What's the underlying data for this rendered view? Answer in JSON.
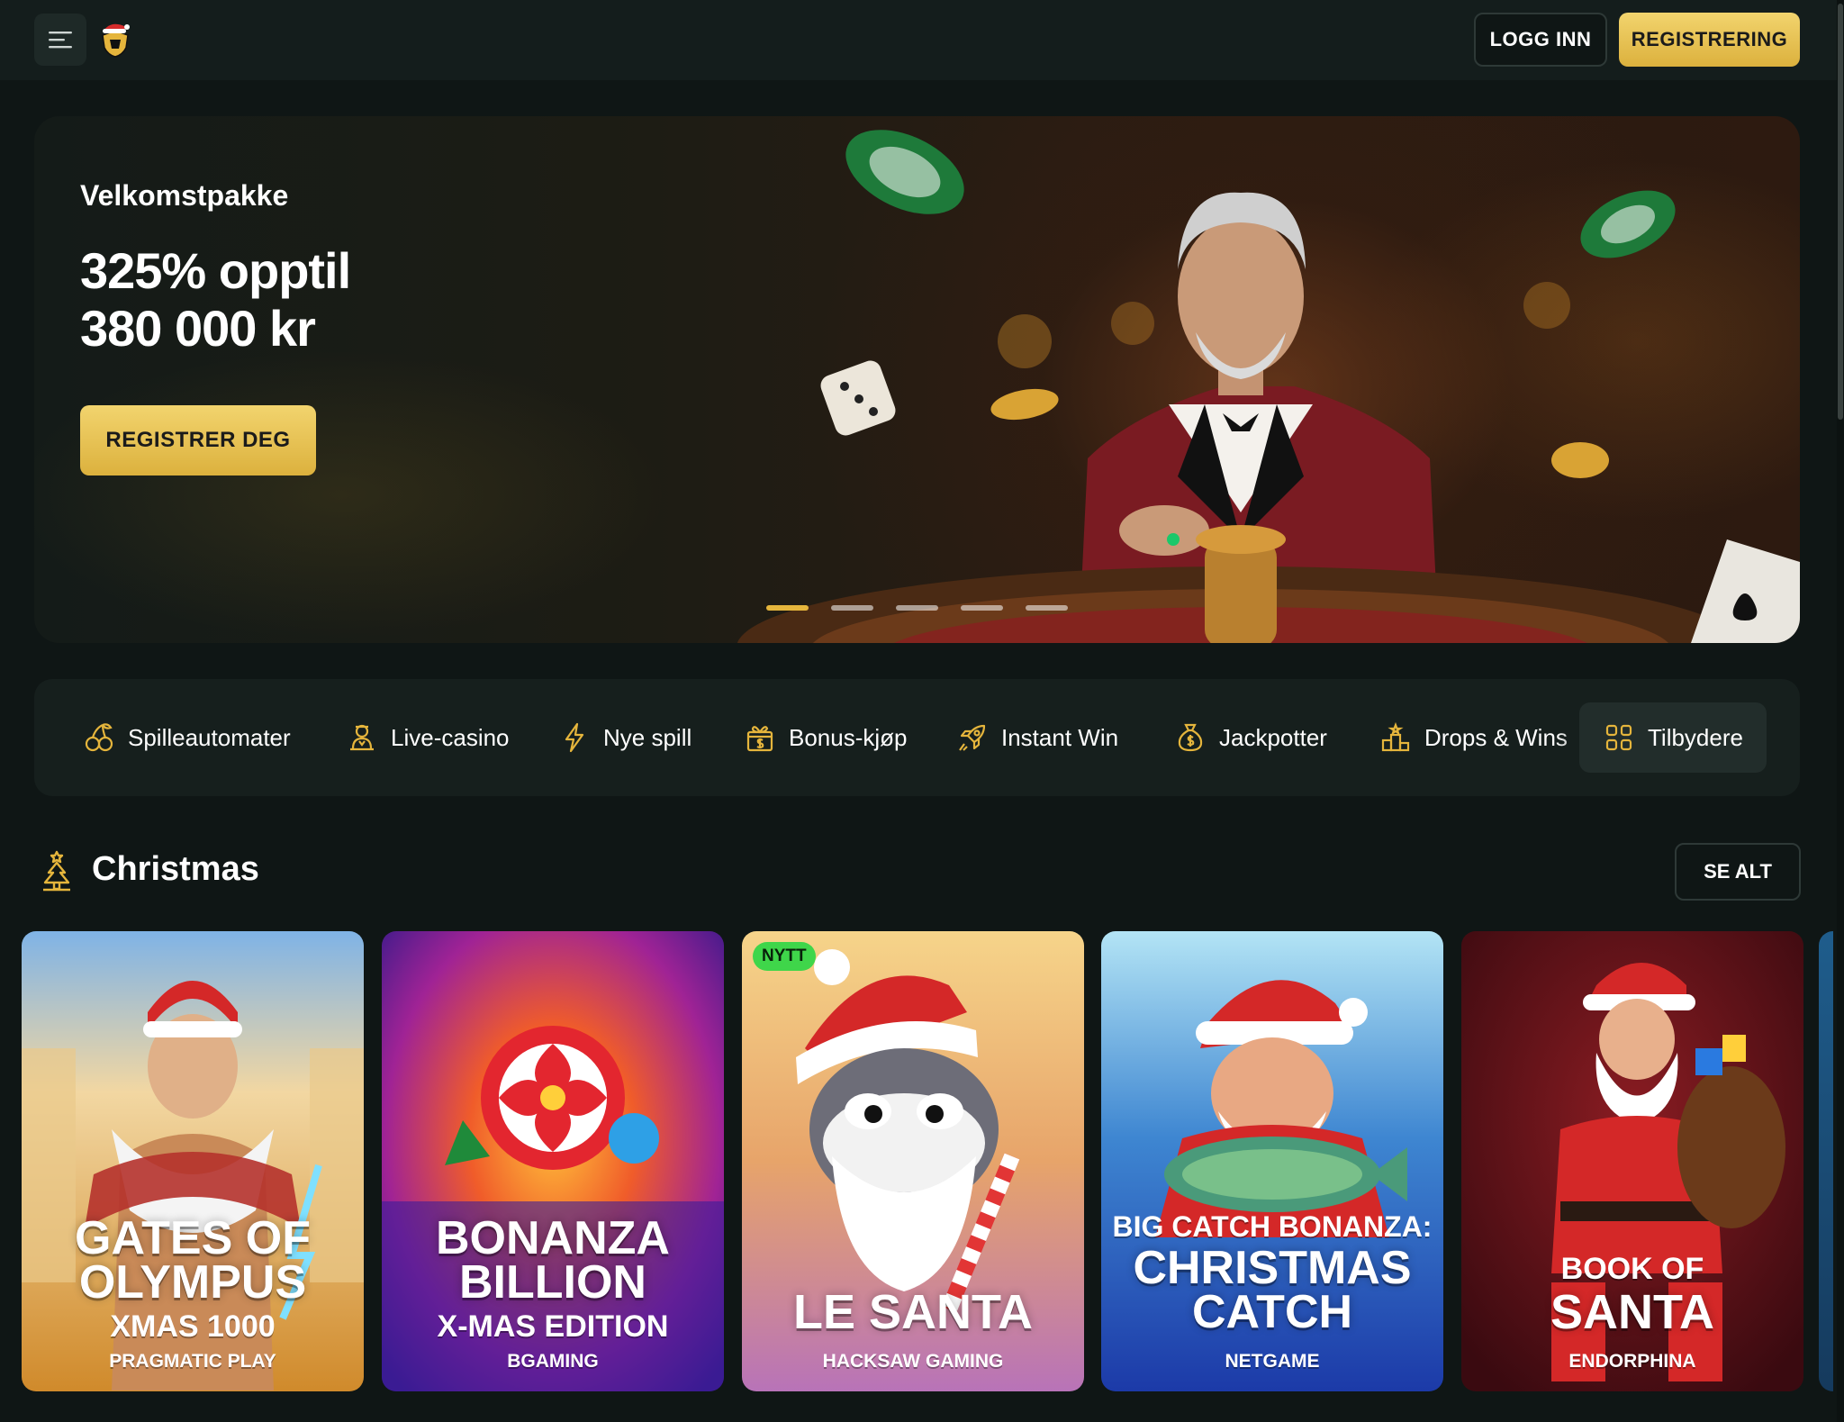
{
  "header": {
    "menu_icon": "menu-icon",
    "logo_icon": "shield-santa-logo",
    "login_label": "LOGG INN",
    "register_label": "REGISTRERING"
  },
  "hero": {
    "title": "Velkomstpakke",
    "offer_line1": "325% opptil",
    "offer_line2": "380 000 kr",
    "cta_label": "REGISTRER DEG",
    "slides_total": 5,
    "active_slide": 1
  },
  "categories": [
    {
      "label": "Spilleautomater",
      "icon": "cherries-icon"
    },
    {
      "label": "Live-casino",
      "icon": "dealer-icon"
    },
    {
      "label": "Nye spill",
      "icon": "lightning-icon"
    },
    {
      "label": "Bonus-kjøp",
      "icon": "gift-dollar-icon"
    },
    {
      "label": "Instant Win",
      "icon": "rocket-icon"
    },
    {
      "label": "Jackpotter",
      "icon": "money-bag-icon"
    },
    {
      "label": "Drops & Wins",
      "icon": "podium-icon"
    },
    {
      "label": "Tilbydere",
      "icon": "grid-icon"
    }
  ],
  "section": {
    "title": "Christmas",
    "icon": "christmas-tree-icon",
    "see_all_label": "SE ALT"
  },
  "games": [
    {
      "line1": "GATES OF",
      "line2": "OLYMPUS",
      "sub": "XMAS 1000",
      "provider": "PRAGMATIC PLAY",
      "badge": ""
    },
    {
      "line1": "BONANZA",
      "line2": "BILLION",
      "sub": "X-MAS EDITION",
      "provider": "BGAMING",
      "badge": ""
    },
    {
      "line1": "LE SANTA",
      "line2": "",
      "sub": "",
      "provider": "HACKSAW GAMING",
      "badge": "NYTT"
    },
    {
      "line1": "BIG CATCH BONANZA:",
      "line2": "CHRISTMAS",
      "sub": "CATCH",
      "provider": "NETGAME",
      "badge": ""
    },
    {
      "line1": "BOOK OF",
      "line2": "SANTA",
      "sub": "",
      "provider": "ENDORPHINA",
      "badge": ""
    }
  ],
  "colors": {
    "accent_gold": "#e5b53c",
    "background": "#0f1615",
    "header": "#141d1c",
    "badge_green": "#3fd64a"
  }
}
